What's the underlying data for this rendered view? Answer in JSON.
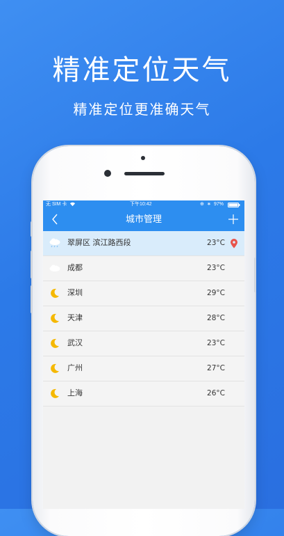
{
  "promo": {
    "headline": "精准定位天气",
    "subline": "精准定位更准确天气"
  },
  "status_bar": {
    "carrier": "无 SIM 卡",
    "time": "下午10:42",
    "battery": "97%"
  },
  "nav": {
    "title": "城市管理",
    "back_icon": "chevron-left-icon",
    "add_icon": "plus-icon"
  },
  "colors": {
    "accent": "#2d8ef0",
    "active_row": "#d9ecfb",
    "pin": "#e8534a",
    "moon": "#f5b800"
  },
  "cities": [
    {
      "name": "翠屏区 滨江路西段",
      "temp": "23°C",
      "icon": "rain-cloud-icon",
      "current": true
    },
    {
      "name": "成都",
      "temp": "23°C",
      "icon": "cloud-icon",
      "current": false
    },
    {
      "name": "深圳",
      "temp": "29°C",
      "icon": "moon-icon",
      "current": false
    },
    {
      "name": "天津",
      "temp": "28°C",
      "icon": "moon-icon",
      "current": false
    },
    {
      "name": "武汉",
      "temp": "23°C",
      "icon": "moon-icon",
      "current": false
    },
    {
      "name": "广州",
      "temp": "27°C",
      "icon": "moon-icon",
      "current": false
    },
    {
      "name": "上海",
      "temp": "26°C",
      "icon": "moon-icon",
      "current": false
    }
  ]
}
